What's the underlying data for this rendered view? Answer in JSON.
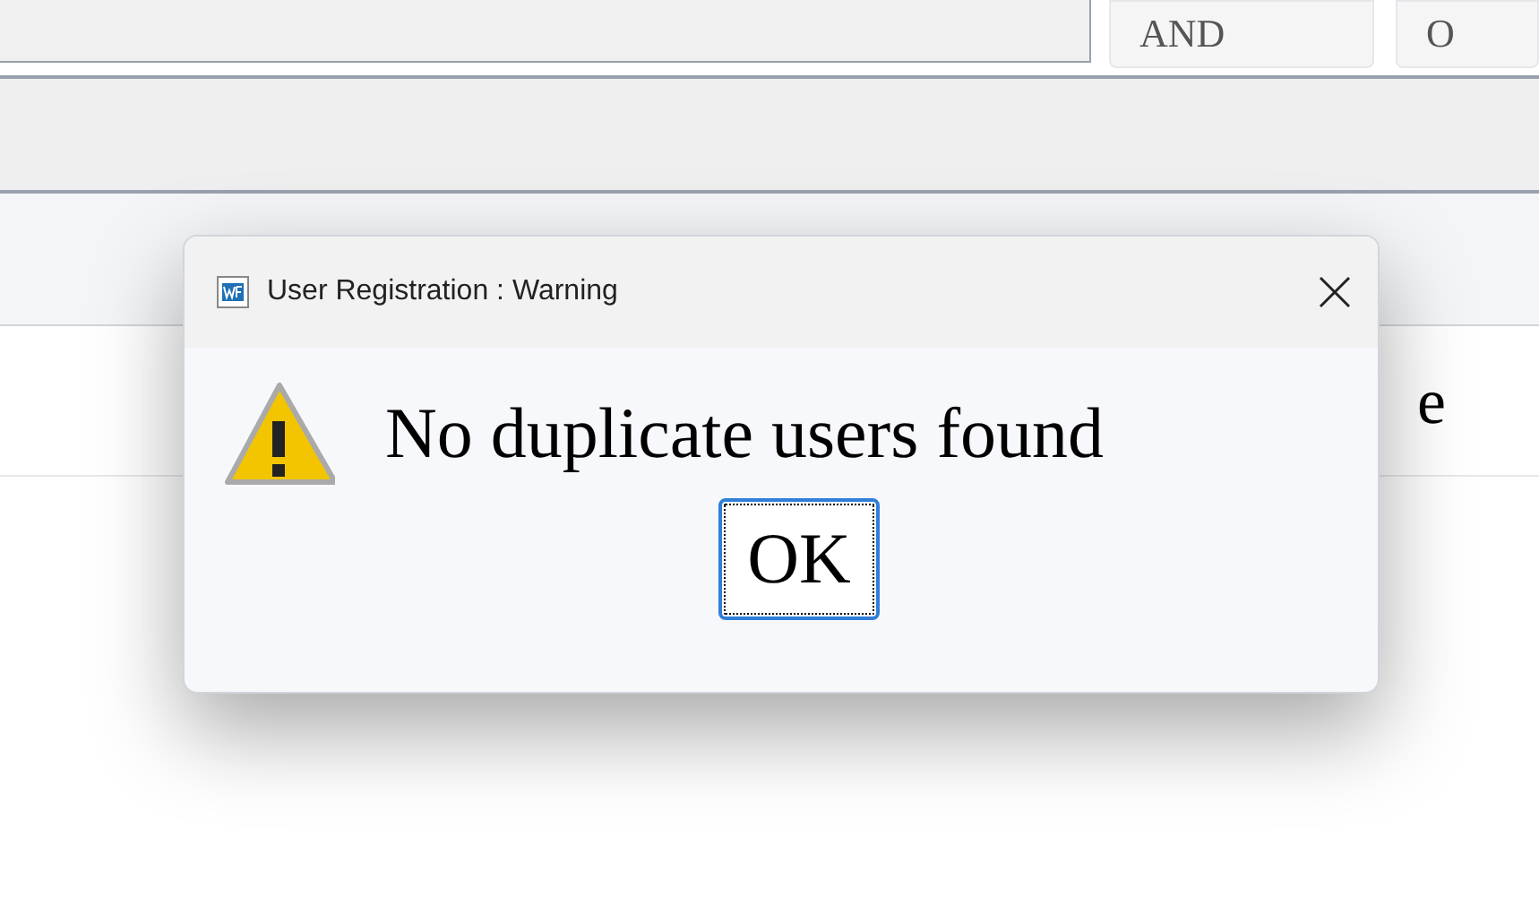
{
  "background": {
    "buttons": [
      "AND",
      "O"
    ],
    "label_fragment": "e"
  },
  "dialog": {
    "title": "User Registration : Warning",
    "message": "No duplicate users found",
    "buttons": [
      {
        "label": "OK",
        "focused": true
      }
    ]
  }
}
